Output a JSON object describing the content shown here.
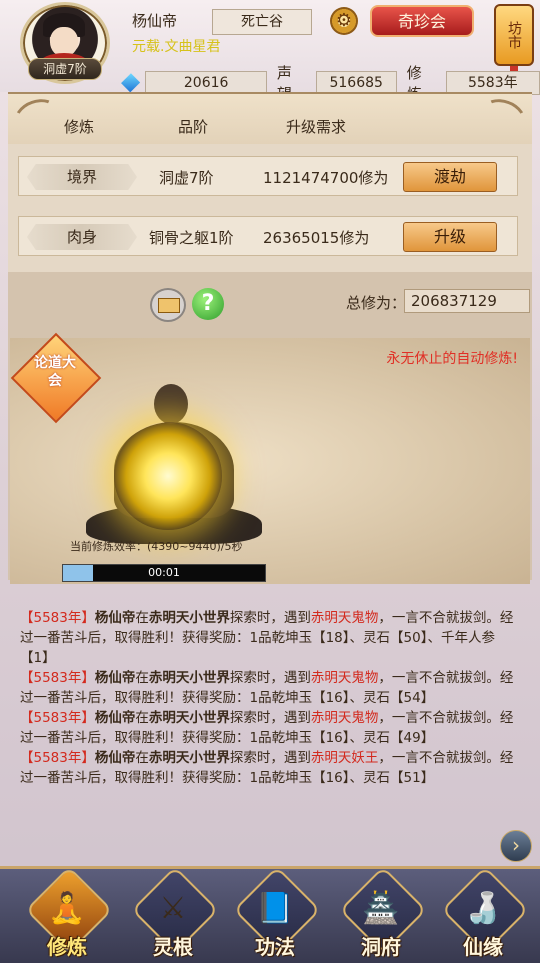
{
  "player": {
    "rank_badge": "洞虚7阶",
    "name": "杨仙帝",
    "title": "元载.文曲星君",
    "sect": "死亡谷",
    "spirit_stones": "20616",
    "fame_label": "声望",
    "fame": "516685",
    "cultivate_label": "修炼",
    "cultivate_years": "5583年"
  },
  "header": {
    "treasure_btn": "奇珍会",
    "market_btn": "坊市",
    "settings_icon": "gear-icon"
  },
  "panel": {
    "col_cultivate": "修炼",
    "col_grade": "品阶",
    "col_requirement": "升级需求",
    "rows": [
      {
        "name": "境界",
        "grade": "洞虚7阶",
        "requirement": "1121474700修为",
        "action": "渡劫"
      },
      {
        "name": "肉身",
        "grade": "铜骨之躯1阶",
        "requirement": "26365015修为",
        "action": "升级"
      }
    ],
    "total_label": "总修为：",
    "total_value": "206837129",
    "auto_text": "永无休止的自动修炼!",
    "lundao_event": "论道大会",
    "efficiency_text": "当前修炼效率：(4390~9440)/5秒",
    "progress_time": "00:01",
    "progress_fraction": 0.15
  },
  "log": [
    {
      "year": "【5583年】",
      "name": "杨仙帝",
      "t1": "在",
      "place": "赤明天小世界",
      "t2": "探索时，遇到",
      "enemy": "赤明天鬼物",
      "t3": "，一言不合就拔剑。经过一番苦斗后，取得胜利！获得奖励：1品乾坤玉【18】、灵石【50】、千年人参【1】"
    },
    {
      "year": "【5583年】",
      "name": "杨仙帝",
      "t1": "在",
      "place": "赤明天小世界",
      "t2": "探索时，遇到",
      "enemy": "赤明天鬼物",
      "t3": "，一言不合就拔剑。经过一番苦斗后，取得胜利！获得奖励：1品乾坤玉【16】、灵石【54】"
    },
    {
      "year": "【5583年】",
      "name": "杨仙帝",
      "t1": "在",
      "place": "赤明天小世界",
      "t2": "探索时，遇到",
      "enemy": "赤明天鬼物",
      "t3": "，一言不合就拔剑。经过一番苦斗后，取得胜利！获得奖励：1品乾坤玉【16】、灵石【49】"
    },
    {
      "year": "【5583年】",
      "name": "杨仙帝",
      "t1": "在",
      "place": "赤明天小世界",
      "t2": "探索时，遇到",
      "enemy": "赤明天妖王",
      "t3": "，一言不合就拔剑。经过一番苦斗后，取得胜利！获得奖励：1品乾坤玉【16】、灵石【51】"
    }
  ],
  "nav": [
    {
      "label": "修炼",
      "icon": "cultivate-icon",
      "active": true
    },
    {
      "label": "灵根",
      "icon": "spirit-root-icon",
      "active": false
    },
    {
      "label": "功法",
      "icon": "scripture-icon",
      "active": false
    },
    {
      "label": "洞府",
      "icon": "cave-dwelling-icon",
      "active": false
    },
    {
      "label": "仙缘",
      "icon": "gourd-icon",
      "active": false
    }
  ],
  "colors": {
    "accent_red": "#d32a1e",
    "title_yellow": "#d6c21a",
    "button_orange": "#e0953b",
    "nav_bg": "#38394f"
  }
}
